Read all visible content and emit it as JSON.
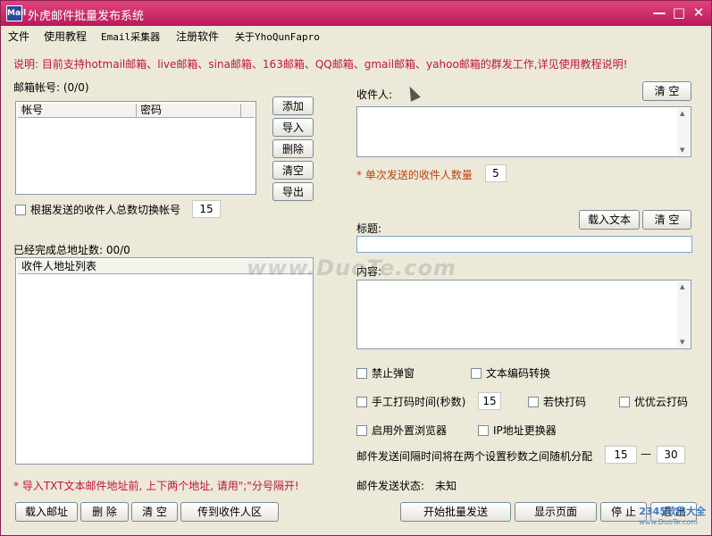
{
  "window": {
    "title": "外虎邮件批量发布系统",
    "icon_name": "app-icon",
    "icon_text": "Mail",
    "minimize": "—",
    "maximize": "□",
    "close": "✕"
  },
  "menu": [
    "文件",
    "使用教程",
    "Email采集器",
    "注册软件",
    "关于YhoQunFapro"
  ],
  "notice": "说明: 目前支持hotmail邮箱、live邮箱、sina邮箱、163邮箱、QQ邮箱、gmail邮箱、yahoo邮箱的群发工作,详见使用教程说明!",
  "accounts": {
    "label": "邮箱帐号: (0/0)",
    "columns": [
      "帐号",
      "密码"
    ],
    "buttons": [
      "添加",
      "导入",
      "删除",
      "清空",
      "导出"
    ],
    "switch_label": "根据发送的收件人总数切换帐号",
    "switch_value": "15"
  },
  "addresses": {
    "label": "已经完成总地址数: 00/0",
    "column": "收件人地址列表",
    "hint": "* 导入TXT文本邮件地址前, 上下两个地址, 请用\";\"分号隔开!",
    "buttons": [
      "载入邮址",
      "删 除",
      "清 空",
      "传到收件人区"
    ]
  },
  "recipient": {
    "label": "收件人:",
    "clear": "清 空",
    "count_label": "* 单次发送的收件人数量",
    "count_value": "5"
  },
  "subject": {
    "label": "标题:",
    "load_text": "载入文本",
    "clear": "清 空",
    "value": ""
  },
  "content": {
    "label": "内容:"
  },
  "options": {
    "block_popup": "禁止弹窗",
    "encode_convert": "文本编码转换",
    "manual_time": "手工打码时间(秒数)",
    "manual_time_value": "15",
    "ruokuai": "若快打码",
    "youyouyun": "优优云打码",
    "external_browser": "启用外置浏览器",
    "ip_switch": "IP地址更换器",
    "interval_label": "邮件发送间隔时间将在两个设置秒数之间随机分配",
    "interval_min": "15",
    "interval_dash": "—",
    "interval_max": "30"
  },
  "status": {
    "label": "邮件发送状态:",
    "value": "未知"
  },
  "actions": [
    "开始批量发送",
    "显示页面",
    "停 止",
    "退 出"
  ],
  "watermark": "www.DuoTe.com",
  "corner_logo": {
    "brand": "2345软件大全",
    "url": "www.DuoTe.com"
  }
}
